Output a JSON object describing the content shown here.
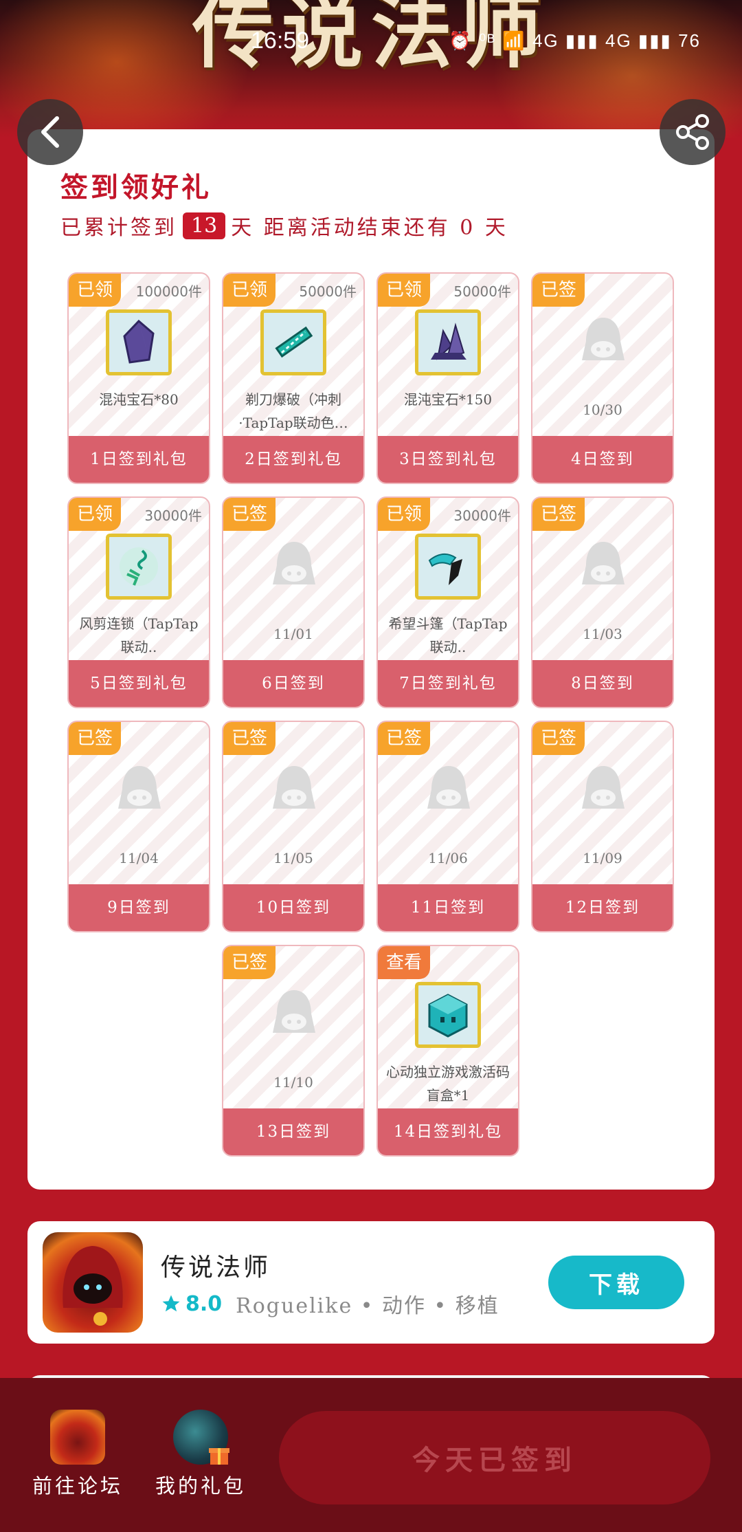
{
  "banner": {
    "title": "传说法师"
  },
  "status_bar": {
    "time": "16:59",
    "icons": "⏰ ⁰ᴮ 📶 4G ▮▮▮ 4G ▮▮▮ 76"
  },
  "checkin": {
    "title": "签到领好礼",
    "subtitle_prefix": "已累计签到",
    "days": "13",
    "subtitle_suffix": "天  距离活动结束还有 0 天"
  },
  "tiles": [
    {
      "tag": "已领",
      "qty": "100000件",
      "icon": "purple-crystal-icon",
      "name": "混沌宝石*80",
      "footer": "1日签到礼包"
    },
    {
      "tag": "已领",
      "qty": "50000件",
      "icon": "blade-burst-icon",
      "name": "剃刀爆破（冲刺·TapTap联动色…",
      "footer": "2日签到礼包"
    },
    {
      "tag": "已领",
      "qty": "50000件",
      "icon": "crystal-cluster-icon",
      "name": "混沌宝石*150",
      "footer": "3日签到礼包"
    },
    {
      "tag": "已签",
      "date": "10/30",
      "footer": "4日签到"
    },
    {
      "tag": "已领",
      "qty": "30000件",
      "icon": "wind-chain-icon",
      "name": "风剪连锁（TapTap联动..",
      "footer": "5日签到礼包"
    },
    {
      "tag": "已签",
      "date": "11/01",
      "footer": "6日签到"
    },
    {
      "tag": "已领",
      "qty": "30000件",
      "icon": "hope-cloak-icon",
      "name": "希望斗篷（TapTap联动..",
      "footer": "7日签到礼包"
    },
    {
      "tag": "已签",
      "date": "11/03",
      "footer": "8日签到"
    },
    {
      "tag": "已签",
      "date": "11/04",
      "footer": "9日签到"
    },
    {
      "tag": "已签",
      "date": "11/05",
      "footer": "10日签到"
    },
    {
      "tag": "已签",
      "date": "11/06",
      "footer": "11日签到"
    },
    {
      "tag": "已签",
      "date": "11/09",
      "footer": "12日签到"
    },
    {
      "tag": "已签",
      "date": "11/10",
      "footer": "13日签到"
    },
    {
      "tag": "查看",
      "icon": "blind-box-icon",
      "name": "心动独立游戏激活码盲盒*1",
      "footer": "14日签到礼包"
    }
  ],
  "game": {
    "name": "传说法师",
    "rating": "8.0",
    "tags": "Roguelike • 动作 • 移植",
    "download_label": "下载"
  },
  "bottom_nav": {
    "forum_label": "前往论坛",
    "gifts_label": "我的礼包",
    "checkin_button": "今天已签到"
  },
  "colors": {
    "background": "#b81725",
    "title_red": "#c3162a",
    "tag_orange": "#f7a32b",
    "tag_view_orange": "#f07a3b",
    "tile_footer": "#d9606c",
    "teal": "#17b9c9",
    "bottom_bar": "#6b0e17"
  }
}
